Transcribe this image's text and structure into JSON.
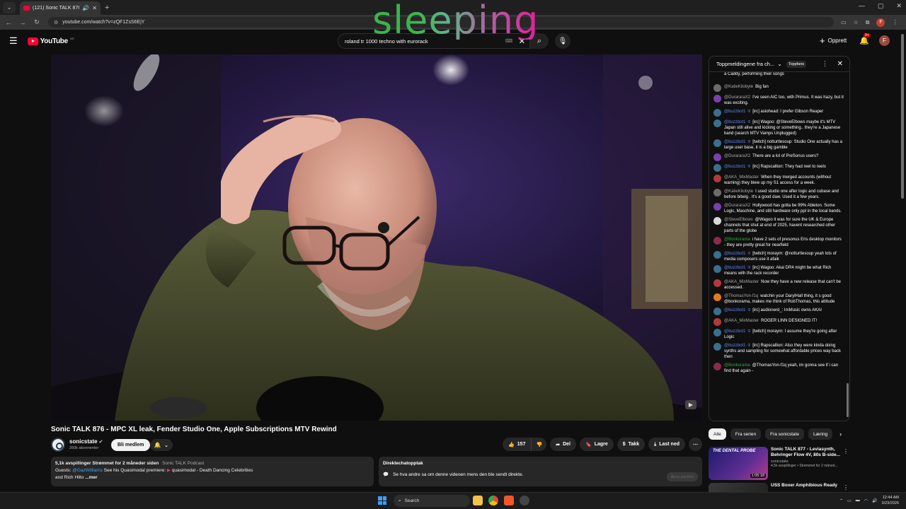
{
  "browser": {
    "tab_title": "(121) Sonic TALK 876 - MPC",
    "url": "youtube.com/watch?v=zQF1ZsS6EjY"
  },
  "masthead": {
    "logo_text": "YouTube",
    "country_code": "NO",
    "search_value": "roland tr 1000 techno with eurorack",
    "create_label": "Opprett",
    "notification_count": "9+",
    "avatar_letter": "F",
    "overlay_word": "sleeping"
  },
  "video": {
    "title": "Sonic TALK 876 - MPC XL leak, Fender Studio One, Apple Subscriptions MTV Rewind"
  },
  "channel": {
    "name": "sonicstate",
    "subscribers": "260k abonnenter",
    "member_label": "Bli medlem"
  },
  "actions": {
    "likes": "157",
    "share": "Del",
    "save": "Lagre",
    "thanks": "Takk",
    "download": "Last ned"
  },
  "description": {
    "meta": "5,1k avspillinger  Strømmet for 2 måneder siden",
    "podcast": "Sonic TALK Podcast",
    "line2_prefix": "Guests: ",
    "guest_link": "@GazWilliams",
    "line2_rest": "See his Quasimodal premiere: ",
    "premiere": "quasimodal - Death Dancing Celebrities",
    "line3": "and Rich Hilto",
    "more": "...mer"
  },
  "replay": {
    "heading": "Direktechatopptak",
    "body": "Se hva andre sa om denne videoen mens den ble sendt direkte.",
    "open_label": "Åpne panelet"
  },
  "chat": {
    "header_title": "Toppmeldingene fra ch...",
    "topfans_label": "Toppfans",
    "first_partial": "a Caddy, performing their songs",
    "messages": [
      {
        "author": "@KatieKilobyte",
        "type": "user",
        "color": "#6b6b6b",
        "text": "Big fan"
      },
      {
        "author": "@DurararaX2",
        "type": "user",
        "color": "#7b3fb0",
        "text": "I've seen AIC too, with Primus. It was hazy, but it was exciting."
      },
      {
        "author": "@buzzbot1",
        "type": "bot",
        "color": "#3b6e8f",
        "text": "[irc] asiohead: I prefer Gibson Reaper"
      },
      {
        "author": "@buzzbot1",
        "type": "bot",
        "color": "#3b6e8f",
        "text": "[irc] Wagoo: @SteveElbows maybe it's MTV Japan still alive and kicking or something.. they're a Japanese band (search MTV Vamps Unplugged)"
      },
      {
        "author": "@buzzbot1",
        "type": "bot",
        "color": "#3b6e8f",
        "text": "[twitch] notturtlesoup: Studio One actually has a large user base, it is a big gamble"
      },
      {
        "author": "@DurararaX2",
        "type": "user",
        "color": "#7b3fb0",
        "text": "There are a lot of PreSonus users?"
      },
      {
        "author": "@buzzbot1",
        "type": "bot",
        "color": "#3b6e8f",
        "text": "[irc] Rapscallion: They had reel to reels"
      },
      {
        "author": "@AKA_MixMaster",
        "type": "user",
        "color": "#b33a3a",
        "text": "When they merged accounts (without warning) they blew up my S1 access for a week."
      },
      {
        "author": "@KatieKilobyte",
        "type": "user",
        "color": "#6b6b6b",
        "text": "I used studio one after logic and cubase and before bitwig . It's a good daw. Used it a few years."
      },
      {
        "author": "@DurararaX2",
        "type": "user",
        "color": "#7b3fb0",
        "text": "Hollywood has gotta be 99% Ableton. Some Logic, Maschine, and still hardware only ppl in the local bands."
      },
      {
        "author": "@SteveElbows",
        "type": "user",
        "color": "#d9d9d9",
        "text": "@Wagoo it was for sure the UK & Europe channels that shut at end of 2025, havent researched other parts of the globe"
      },
      {
        "author": "@Bonkorama",
        "type": "member",
        "color": "#8a2b4a",
        "text": "i have 2 sets of presonus Eris desktop monitors - they are pretty great for nearfield"
      },
      {
        "author": "@buzzbot1",
        "type": "bot",
        "color": "#3b6e8f",
        "text": "[twitch] moraym: @notturtlesoup yeah lots of media composers use it afaik"
      },
      {
        "author": "@buzzbot1",
        "type": "bot",
        "color": "#3b6e8f",
        "text": "[irc] Wagoo: Akai DR4 might be what Rich means with the rack recorder"
      },
      {
        "author": "@AKA_MixMaster",
        "type": "user",
        "color": "#b33a3a",
        "text": "Now they have a new release that can't be accessed."
      },
      {
        "author": "@ThomasYon-f1q",
        "type": "user",
        "color": "#e07a1f",
        "text": "watchin your DarylHall thing, it s good @bonkorama, makes me think of RobThomas, this attitude"
      },
      {
        "author": "@buzzbot1",
        "type": "bot",
        "color": "#3b6e8f",
        "text": "[irc] audionerd_: ImMusic owns AKAI"
      },
      {
        "author": "@AKA_MixMaster",
        "type": "user",
        "color": "#b33a3a",
        "text": "ROGER LINN DESIGNED IT!"
      },
      {
        "author": "@buzzbot1",
        "type": "bot",
        "color": "#3b6e8f",
        "text": "[twitch] moraym: I assume they're going after Logic"
      },
      {
        "author": "@buzzbot1",
        "type": "bot",
        "color": "#3b6e8f",
        "text": "[irc] Rapscallion: Also they were kinda doing synths and sampling for somewhat affordable prices way back then"
      },
      {
        "author": "@Bonkorama",
        "type": "member",
        "color": "#8a2b4a",
        "text": "@ThomasYon-f1q yeah, im gonna see if i can find that again -"
      }
    ]
  },
  "chips": [
    "Alle",
    "Fra serien",
    "Fra sonicstate",
    "Læring"
  ],
  "recommendations": [
    {
      "thumb_text": "THE DENTAL PROBE",
      "duration": "1:05:18",
      "title": "Sonic TALK 877 - Leviasynth, Behringer Flow 4V, 80s B-side...",
      "channel": "sonicstate",
      "meta": "4,5k avspillinger • Strømmet for 2 måned..."
    },
    {
      "thumb_text": "",
      "duration": "",
      "title": "USS Boxer Amphibious Ready",
      "channel": "",
      "meta": ""
    }
  ],
  "taskbar": {
    "search_placeholder": "Search",
    "time": "12:44 AM",
    "date": "3/23/2026"
  }
}
